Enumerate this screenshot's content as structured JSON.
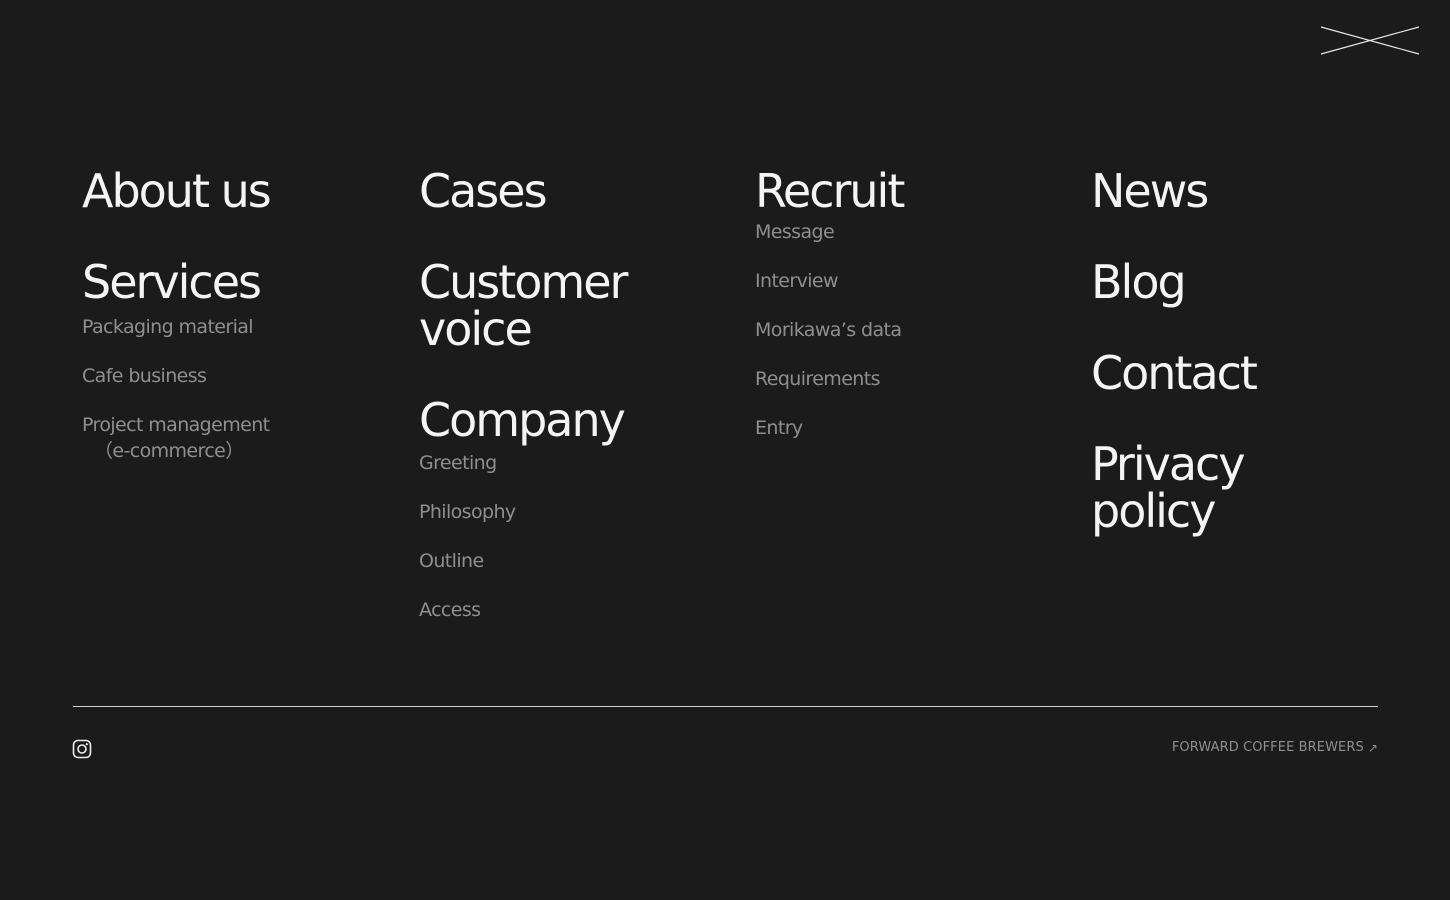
{
  "close_button": {
    "label": "",
    "icon": "close-icon"
  },
  "columns": {
    "about": {
      "heading": "About us"
    },
    "services": {
      "heading": "Services",
      "items": [
        {
          "label": "Packaging material"
        },
        {
          "label": "Cafe business"
        },
        {
          "label": "Project management",
          "label_line2": "（e-commerce）"
        }
      ]
    },
    "cases": {
      "heading": "Cases"
    },
    "customer_voice": {
      "heading_line1": "Customer",
      "heading_line2": "voice"
    },
    "company": {
      "heading": "Company",
      "items": [
        {
          "label": "Greeting"
        },
        {
          "label": "Philosophy"
        },
        {
          "label": "Outline"
        },
        {
          "label": "Access"
        }
      ]
    },
    "recruit": {
      "heading": "Recruit",
      "items": [
        {
          "label": "Message"
        },
        {
          "label": "Interview"
        },
        {
          "label": "Morikawa’s data"
        },
        {
          "label": "Requirements"
        },
        {
          "label": "Entry"
        }
      ]
    },
    "news": {
      "heading": "News"
    },
    "blog": {
      "heading": "Blog"
    },
    "contact": {
      "heading": "Contact"
    },
    "privacy": {
      "heading_line1": "Privacy",
      "heading_line2": "policy"
    }
  },
  "footer": {
    "social_icon": "instagram-icon",
    "brand_link": "FORWARD COFFEE BREWERS",
    "brand_arrow": "↗"
  },
  "colors": {
    "background": "#1b1b1b",
    "heading": "#f4f4f4",
    "subitem": "#8f8f8f",
    "divider": "#cfcfcf"
  }
}
